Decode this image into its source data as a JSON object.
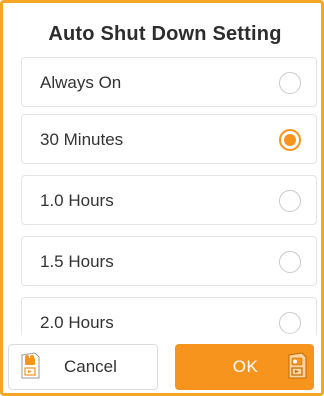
{
  "dialog": {
    "title": "Auto Shut Down Setting"
  },
  "options": [
    {
      "label": "Always On",
      "selected": false
    },
    {
      "label": "30 Minutes",
      "selected": true
    },
    {
      "label": "1.0 Hours",
      "selected": false
    },
    {
      "label": "1.5 Hours",
      "selected": false
    },
    {
      "label": "2.0 Hours",
      "selected": false
    }
  ],
  "buttons": {
    "cancel_label": "Cancel",
    "ok_label": "OK"
  },
  "icons": {
    "cancel_button_icon": "camera-page-icon",
    "ok_button_icon": "camera-page-icon",
    "radio_selected": "radio-checked-icon",
    "radio_unselected": "radio-unchecked-icon"
  },
  "colors": {
    "accent": "#f7941d",
    "frame_border": "#f5a623",
    "title_text": "#2d2d2d",
    "ok_text": "#ffffff"
  }
}
